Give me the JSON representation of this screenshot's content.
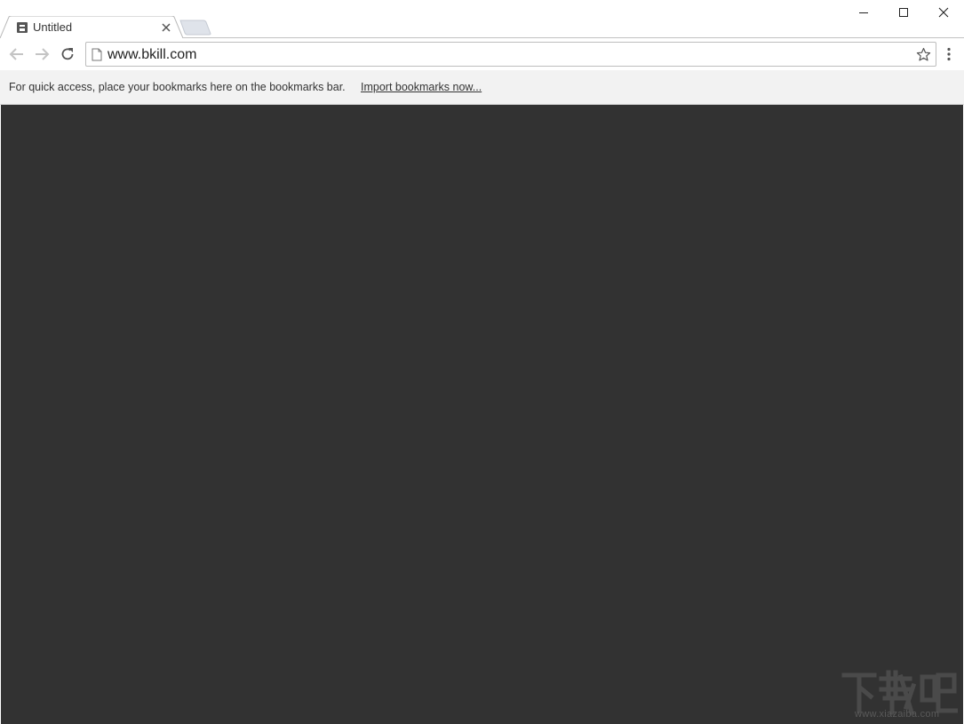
{
  "browser": {
    "tabs": [
      {
        "title": "Untitled",
        "active": true,
        "favicon": "page-folder-icon"
      }
    ],
    "window_controls": [
      "minimize-icon",
      "maximize-icon",
      "close-icon"
    ]
  },
  "toolbar": {
    "url": "www.bkill.com",
    "back_enabled": false,
    "forward_enabled": false
  },
  "bookmarks_bar": {
    "message": "For quick access, place your bookmarks here on the bookmarks bar.",
    "import_link": "Import bookmarks now..."
  },
  "content": {
    "background": "#323232"
  },
  "watermark": {
    "subtext": "www.xiazaiba.com"
  },
  "colors": {
    "content_bg": "#323232",
    "bookmarks_bg": "#f2f2f2",
    "tab_text": "#333333"
  }
}
